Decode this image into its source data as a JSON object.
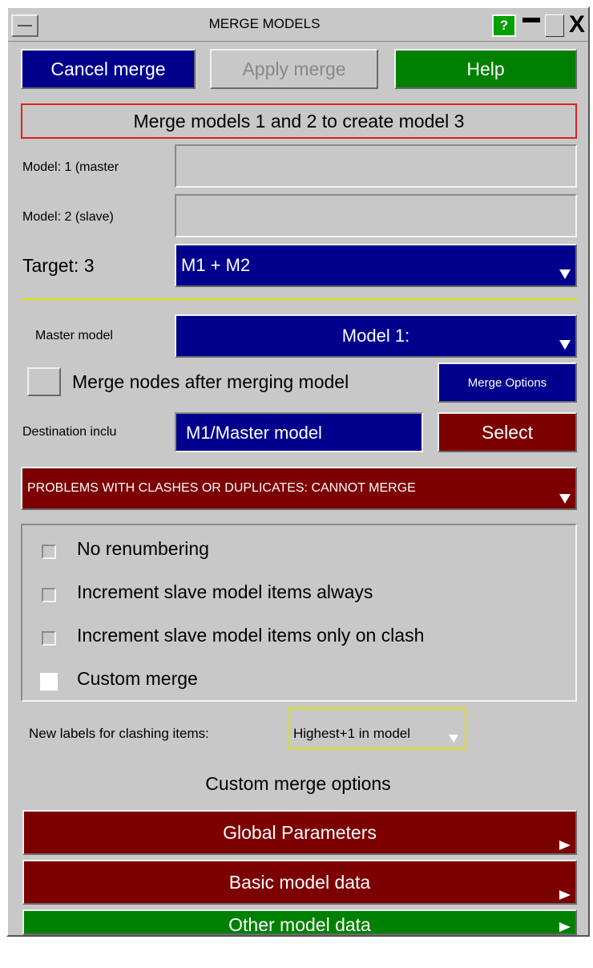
{
  "window": {
    "title": "MERGE MODELS",
    "help_glyph": "?",
    "minimize_glyph": "",
    "maximize_glyph": "",
    "close_glyph": "X"
  },
  "actions": {
    "cancel": "Cancel merge",
    "apply": "Apply merge",
    "help": "Help"
  },
  "status": {
    "message": "Merge models 1 and 2 to create model 3"
  },
  "models": {
    "model1_label": "Model: 1 (master",
    "model1_value": "",
    "model2_label": "Model: 2 (slave)",
    "model2_value": "",
    "target_label": "Target: 3",
    "target_value": "M1 + M2"
  },
  "master": {
    "label": "Master model",
    "value": "Model 1:",
    "merge_nodes_label": "Merge nodes after merging model",
    "merge_nodes_checked": false,
    "merge_options_label": "Merge Options",
    "destination_label": "Destination inclu",
    "destination_value": "M1/Master model",
    "select_label": "Select"
  },
  "problem": {
    "text": "PROBLEMS WITH CLASHES OR DUPLICATES: CANNOT MERGE"
  },
  "renumber_options": [
    {
      "label": "No renumbering",
      "checked": false
    },
    {
      "label": "Increment slave model items always",
      "checked": false
    },
    {
      "label": "Increment slave model items only on clash",
      "checked": false
    },
    {
      "label": "Custom merge",
      "checked": true
    }
  ],
  "clash": {
    "label": "New labels for clashing items:",
    "value": "Highest+1 in model"
  },
  "custom": {
    "heading": "Custom merge options",
    "buttons": [
      {
        "label": "Global Parameters"
      },
      {
        "label": "Basic model data"
      },
      {
        "label": "Other model data"
      }
    ]
  },
  "colors": {
    "panel": "#c8c8c8",
    "blue": "#00008c",
    "green": "#008000",
    "red": "#7d0000",
    "status_border": "#e02020",
    "yellow": "#e0e000"
  }
}
